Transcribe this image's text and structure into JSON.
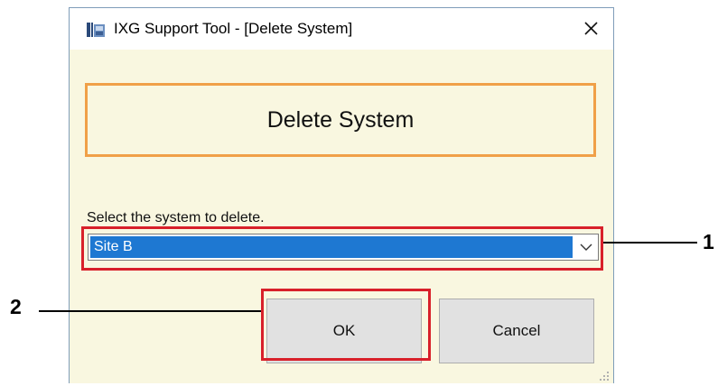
{
  "window": {
    "title": "IXG Support Tool - [Delete System]",
    "icon": "ixg-app-icon",
    "close_icon": "close-icon"
  },
  "header": {
    "title": "Delete System"
  },
  "form": {
    "prompt": "Select the system to delete.",
    "selected_system": "Site B",
    "dropdown_icon": "chevron-down-icon"
  },
  "buttons": {
    "ok_label": "OK",
    "cancel_label": "Cancel"
  },
  "callouts": {
    "one": "1",
    "two": "2"
  },
  "colors": {
    "dialog_background": "#f9f7e0",
    "header_border": "#f0a048",
    "selection_highlight": "#1e78d2",
    "annotation_red": "#d8202a"
  }
}
